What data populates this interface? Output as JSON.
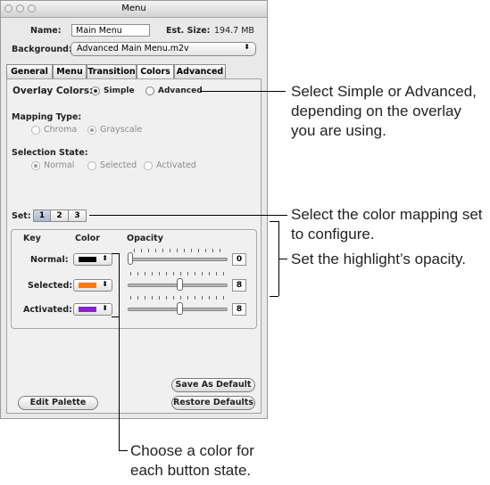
{
  "window": {
    "title": "Menu"
  },
  "name_label": "Name:",
  "name_value": "Main Menu",
  "est_size_label": "Est. Size:",
  "est_size_value": "194.7 MB",
  "background_label": "Background:",
  "background_value": "Advanced Main Menu.m2v",
  "tabs": [
    {
      "label": "General"
    },
    {
      "label": "Menu"
    },
    {
      "label": "Transition"
    },
    {
      "label": "Colors"
    },
    {
      "label": "Advanced"
    }
  ],
  "overlay": {
    "label": "Overlay Colors:",
    "simple": "Simple",
    "advanced": "Advanced",
    "selected": "Simple"
  },
  "mapping": {
    "label": "Mapping Type:",
    "chroma": "Chroma",
    "grayscale": "Grayscale",
    "selected": "Grayscale"
  },
  "selection_state": {
    "label": "Selection State:",
    "normal": "Normal",
    "selected_opt": "Selected",
    "activated": "Activated",
    "selected": "Normal"
  },
  "set": {
    "label": "Set:",
    "options": [
      "1",
      "2",
      "3"
    ],
    "selected": "1"
  },
  "table": {
    "headers": {
      "key": "Key",
      "color": "Color",
      "opacity": "Opacity"
    },
    "rows": [
      {
        "label": "Normal:",
        "color": "#000000",
        "opacity": "0"
      },
      {
        "label": "Selected:",
        "color": "#ff7a00",
        "opacity": "8"
      },
      {
        "label": "Activated:",
        "color": "#8c1ed8",
        "opacity": "8"
      }
    ]
  },
  "buttons": {
    "save_default": "Save As Default",
    "edit_palette": "Edit Palette",
    "restore_defaults": "Restore Defaults"
  },
  "callouts": {
    "overlay": "Select Simple or Advanced, depending on the overlay you are using.",
    "set": "Select the color mapping set to configure.",
    "opacity": "Set the highlight’s opacity.",
    "color": "Choose a color for each button state."
  }
}
